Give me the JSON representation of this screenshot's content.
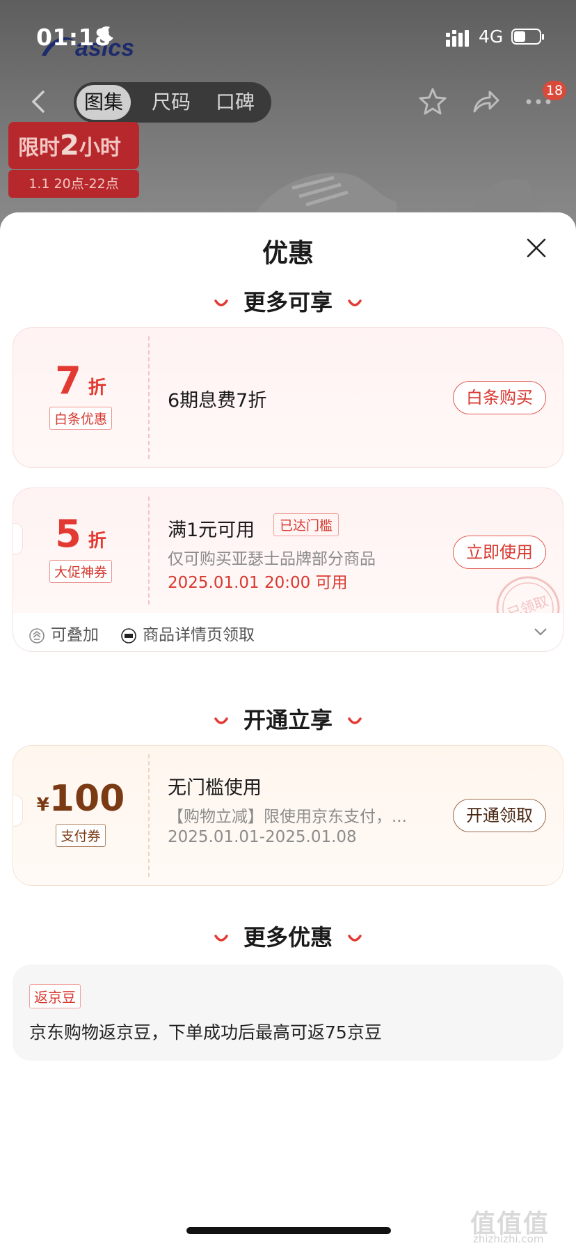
{
  "status_bar": {
    "time": "01:18",
    "network": "4G"
  },
  "product_nav": {
    "tabs": [
      "图集",
      "尺码",
      "口碑"
    ],
    "active_tab": "图集",
    "cart_badge": "18"
  },
  "promo_banner": {
    "prefix": "限时",
    "number": "2",
    "suffix": "小时",
    "schedule": "1.1 20点-22点"
  },
  "sheet": {
    "title": "优惠",
    "section_more_enjoy": "更多可享",
    "coupons": [
      {
        "value": "7",
        "unit": "折",
        "tag": "白条优惠",
        "title": "6期息费7折",
        "button": "白条购买"
      },
      {
        "value": "5",
        "unit": "折",
        "tag": "大促神券",
        "title": "满1元可用",
        "threshold": "已达门槛",
        "desc": "仅可购买亚瑟士品牌部分商品",
        "time": "2025.01.01 20:00 可用",
        "button": "立即使用",
        "stamp": "已领取"
      }
    ],
    "coupon_extras": {
      "stackable": "可叠加",
      "source": "商品详情页领取"
    },
    "section_open": "开通立享",
    "pay_coupon": {
      "currency": "¥",
      "value": "100",
      "tag": "支付券",
      "title": "无门槛使用",
      "desc": "【购物立减】限使用京东支付，...",
      "period": "2025.01.01-2025.01.08",
      "button": "开通领取"
    },
    "section_more_offers": "更多优惠",
    "jingdou": {
      "tag": "返京豆",
      "text": "京东购物返京豆，下单成功后最高可返75京豆"
    }
  },
  "watermark": {
    "main": "值值值",
    "sub": "zhizhizhi.com"
  },
  "colors": {
    "accent_red": "#e23a32",
    "gold_brown": "#7a3a14",
    "overlay_grey": "#6b6b6b"
  }
}
